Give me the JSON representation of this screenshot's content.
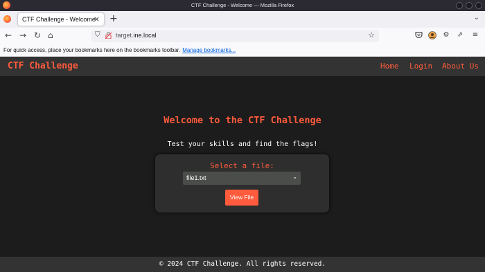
{
  "window": {
    "title": "CTF Challenge - Welcome — Mozilla Firefox"
  },
  "browser": {
    "tab_title": "CTF Challenge - Welcome",
    "tab_close": "×",
    "new_tab": "+",
    "url_host_prefix": "target.",
    "url_host_main": "ine.local",
    "bookmarks_text": "For quick access, place your bookmarks here on the bookmarks toolbar.",
    "bookmarks_link": "Manage bookmarks..."
  },
  "site": {
    "brand": "CTF Challenge",
    "nav": [
      "Home",
      "Login",
      "About Us"
    ],
    "heading": "Welcome to the CTF Challenge",
    "subheading": "Test your skills and find the flags!",
    "form": {
      "label": "Select a file:",
      "selected": "file1.txt",
      "button": "View File"
    },
    "footer": "© 2024 CTF Challenge. All rights reserved."
  },
  "colors": {
    "accent": "#ff5b3c",
    "header_bg": "#333333",
    "page_bg": "#1c1c1c",
    "card_bg": "#2e2e2e"
  },
  "icons": [
    "firefox-icon",
    "back-icon",
    "forward-icon",
    "reload-icon",
    "home-icon",
    "shield-icon",
    "lock-icon",
    "star-icon",
    "pocket-icon",
    "account-icon",
    "extensions-icon",
    "share-icon",
    "menu-icon"
  ]
}
